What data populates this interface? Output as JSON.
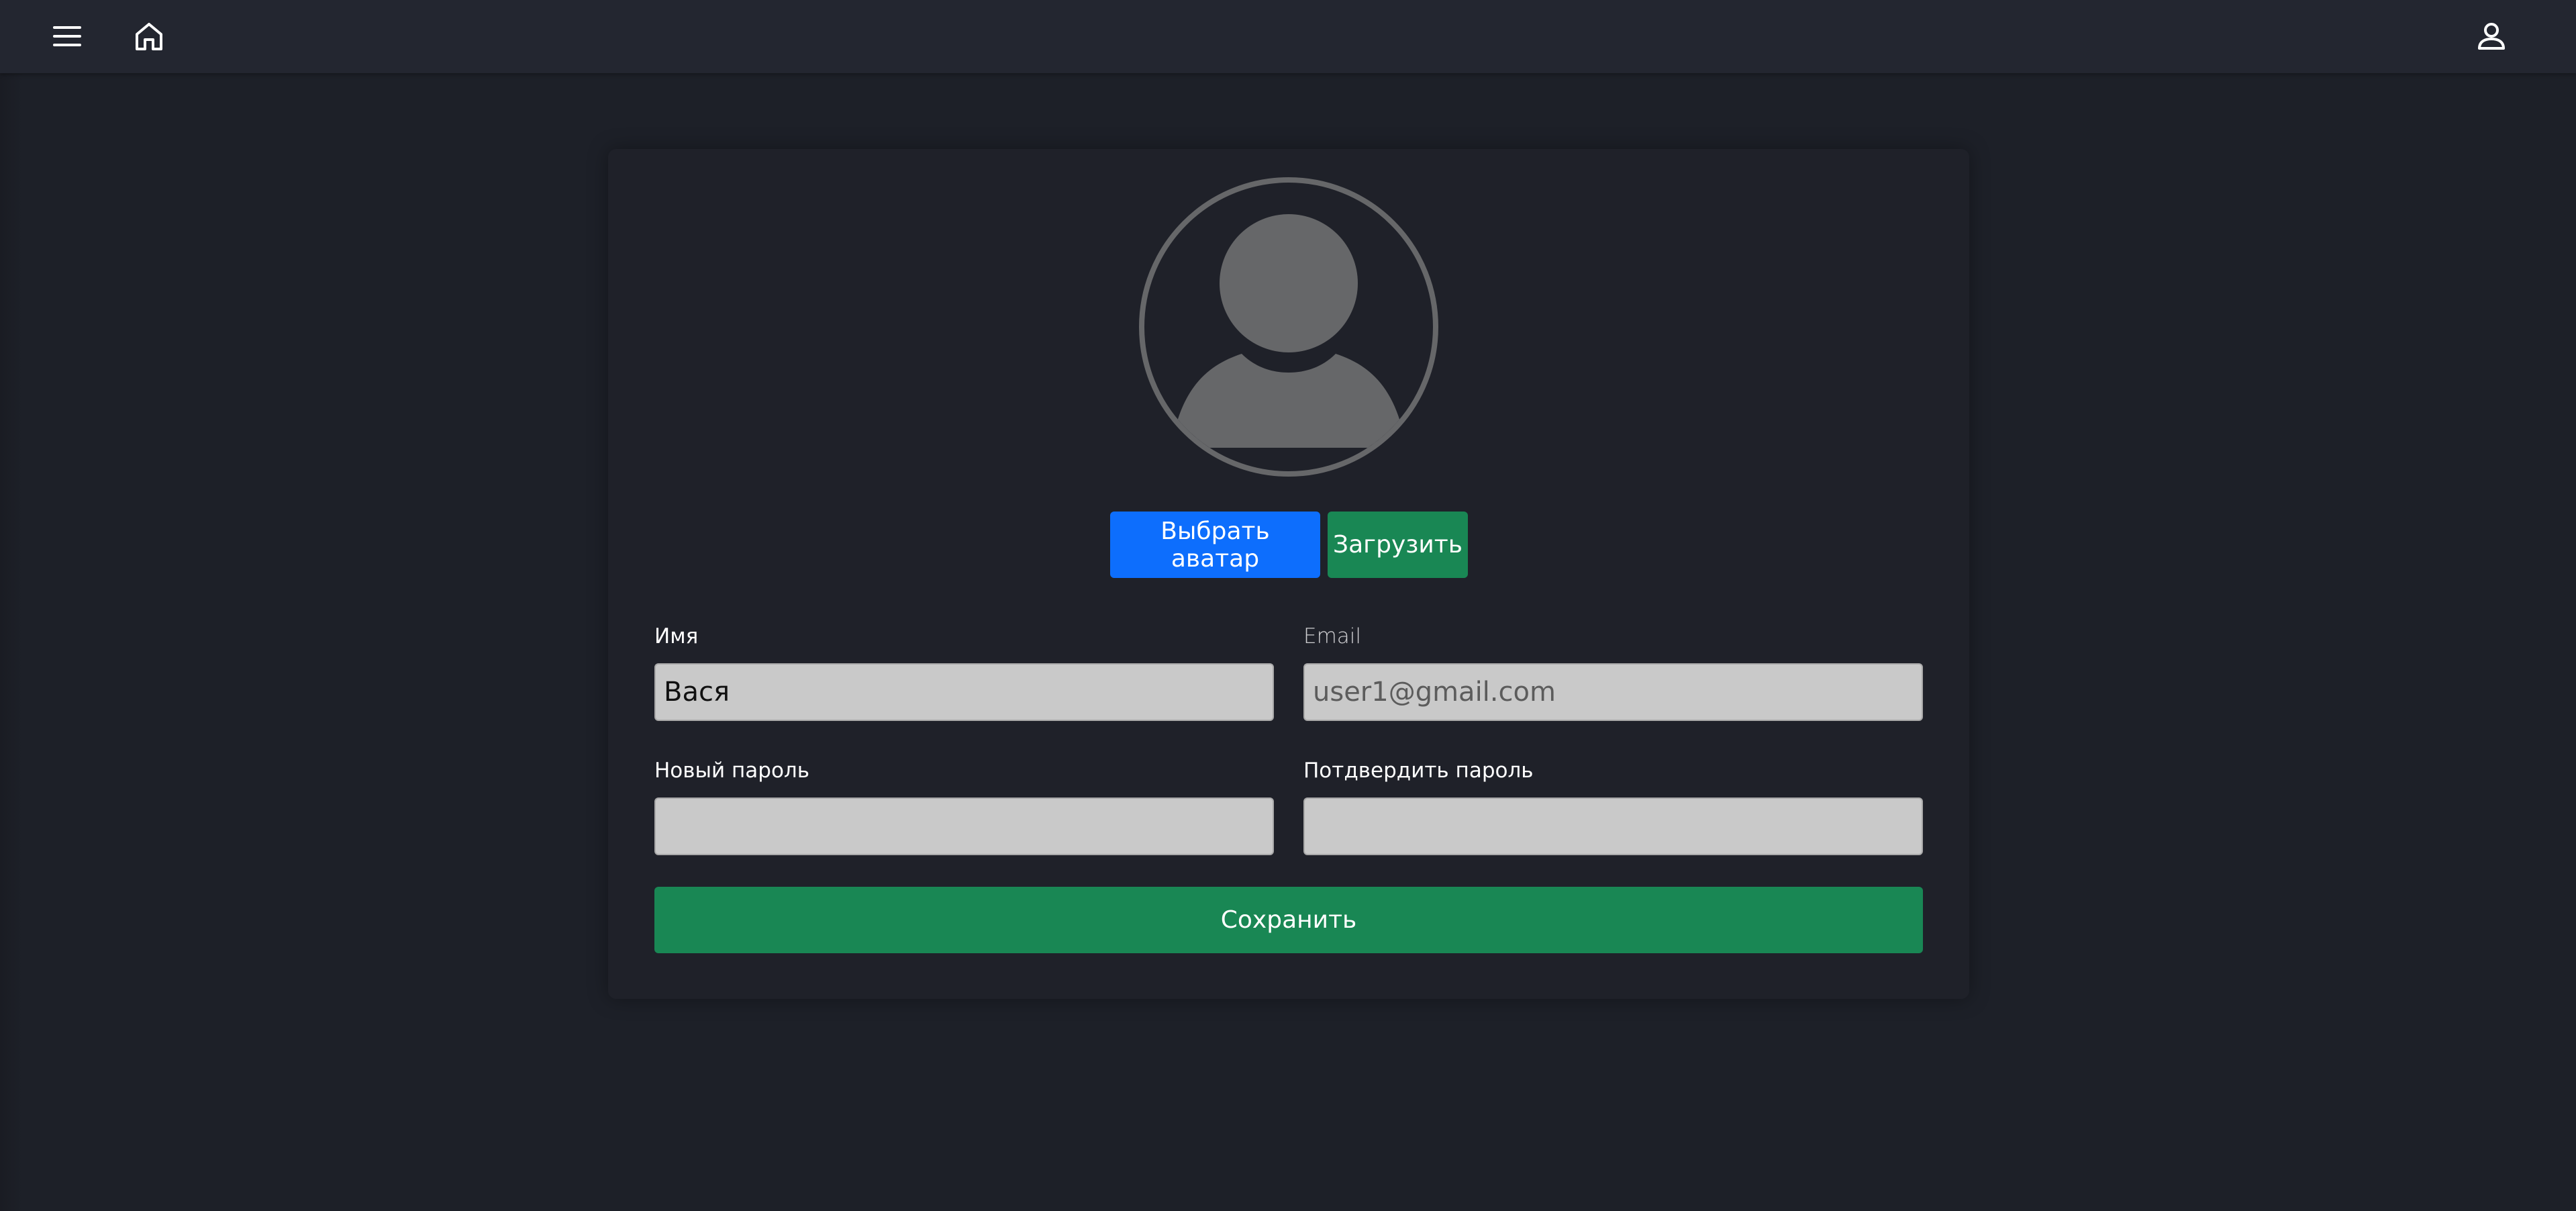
{
  "header": {
    "menu_icon": "menu-icon",
    "home_icon": "home-icon",
    "user_icon": "user-icon"
  },
  "profile": {
    "avatar_icon": "avatar-placeholder-icon",
    "choose_avatar_label": "Выбрать аватар",
    "upload_label": "Загрузить",
    "name_label": "Имя",
    "name_value": "Вася",
    "email_label": "Email",
    "email_value": "user1@gmail.com",
    "new_password_label": "Новый пароль",
    "new_password_value": "",
    "confirm_password_label": "Потдвердить пароль",
    "confirm_password_value": "",
    "save_label": "Сохранить"
  },
  "colors": {
    "background": "#1d2028",
    "topbar": "#232630",
    "card": "#1f2129",
    "primary": "#0d6efd",
    "success": "#198754",
    "input_bg": "#c9c9c9"
  }
}
